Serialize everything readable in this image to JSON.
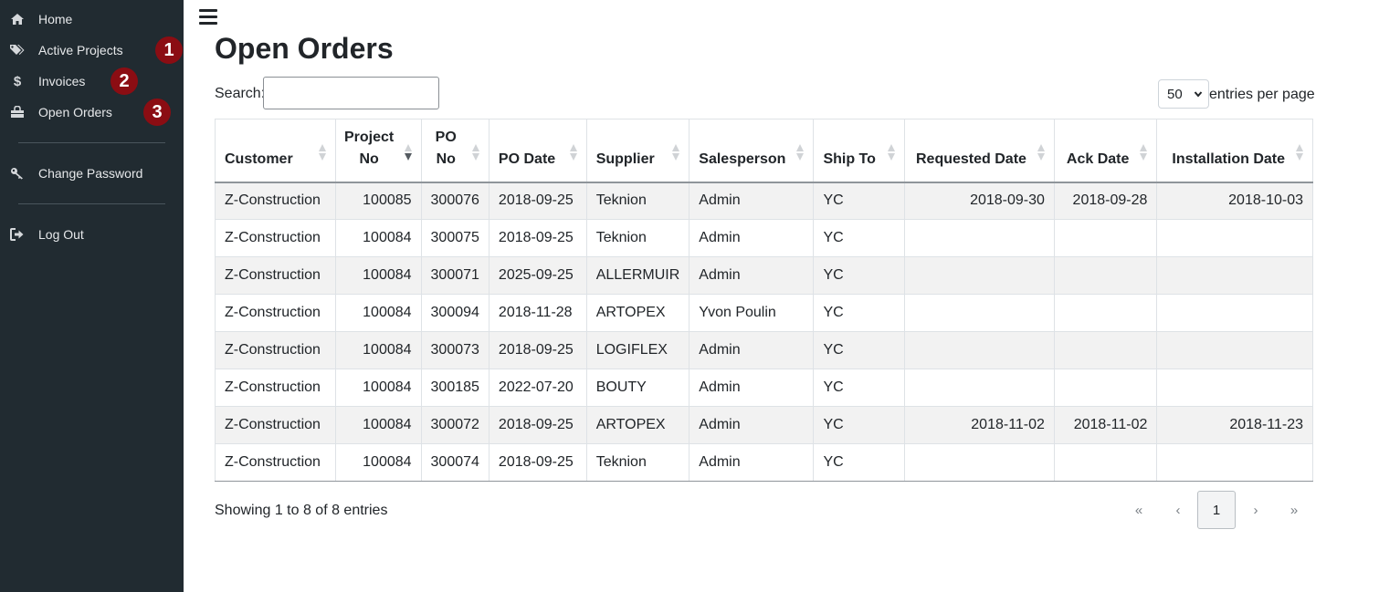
{
  "sidebar": {
    "items": [
      {
        "label": "Home",
        "icon": "home-icon"
      },
      {
        "label": "Active Projects",
        "icon": "tags-icon"
      },
      {
        "label": "Invoices",
        "icon": "dollar-icon"
      },
      {
        "label": "Open Orders",
        "icon": "shopping-bag-icon"
      },
      {
        "label": "Change Password",
        "icon": "key-icon"
      },
      {
        "label": "Log Out",
        "icon": "sign-out-icon"
      }
    ],
    "badges": [
      "1",
      "2",
      "3"
    ],
    "background_color": "#212b31",
    "badge_color": "#8b0d13"
  },
  "page": {
    "title": "Open Orders",
    "search_label": "Search:",
    "search_value": "",
    "per_page_value": "50",
    "per_page_label": "entries per page"
  },
  "table": {
    "columns": [
      {
        "label": "Customer",
        "sort": "both"
      },
      {
        "label": "Project No",
        "sort": "desc"
      },
      {
        "label": "PO No",
        "sort": "both"
      },
      {
        "label": "PO Date",
        "sort": "both"
      },
      {
        "label": "Supplier",
        "sort": "both"
      },
      {
        "label": "Salesperson",
        "sort": "both"
      },
      {
        "label": "Ship To",
        "sort": "both"
      },
      {
        "label": "Requested Date",
        "sort": "both"
      },
      {
        "label": "Ack Date",
        "sort": "both"
      },
      {
        "label": "Installation Date",
        "sort": "both"
      }
    ],
    "rows": [
      [
        "Z-Construction",
        "100085",
        "300076",
        "2018-09-25",
        "Teknion",
        "Admin",
        "YC",
        "2018-09-30",
        "2018-09-28",
        "2018-10-03"
      ],
      [
        "Z-Construction",
        "100084",
        "300075",
        "2018-09-25",
        "Teknion",
        "Admin",
        "YC",
        "",
        "",
        ""
      ],
      [
        "Z-Construction",
        "100084",
        "300071",
        "2025-09-25",
        "ALLERMUIR",
        "Admin",
        "YC",
        "",
        "",
        ""
      ],
      [
        "Z-Construction",
        "100084",
        "300094",
        "2018-11-28",
        "ARTOPEX",
        "Yvon Poulin",
        "YC",
        "",
        "",
        ""
      ],
      [
        "Z-Construction",
        "100084",
        "300073",
        "2018-09-25",
        "LOGIFLEX",
        "Admin",
        "YC",
        "",
        "",
        ""
      ],
      [
        "Z-Construction",
        "100084",
        "300185",
        "2022-07-20",
        "BOUTY",
        "Admin",
        "YC",
        "",
        "",
        ""
      ],
      [
        "Z-Construction",
        "100084",
        "300072",
        "2018-09-25",
        "ARTOPEX",
        "Admin",
        "YC",
        "2018-11-02",
        "2018-11-02",
        "2018-11-23"
      ],
      [
        "Z-Construction",
        "100084",
        "300074",
        "2018-09-25",
        "Teknion",
        "Admin",
        "YC",
        "",
        "",
        ""
      ]
    ]
  },
  "footer": {
    "showing": "Showing 1 to 8 of 8 entries",
    "pagination": {
      "first": "«",
      "prev": "‹",
      "current": "1",
      "next": "›",
      "last": "»"
    }
  }
}
